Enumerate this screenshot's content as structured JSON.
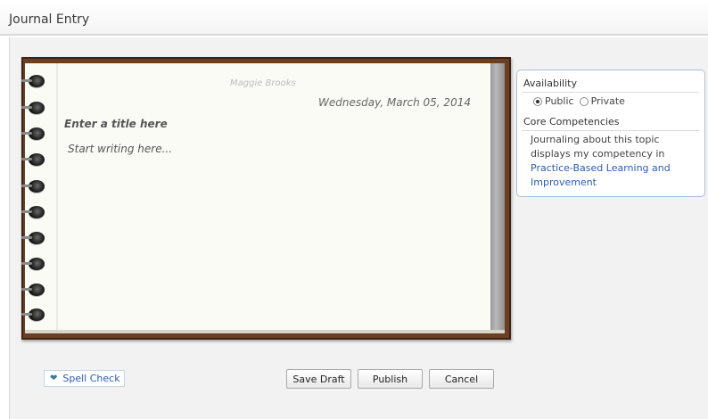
{
  "header": {
    "title": "Journal Entry"
  },
  "journal": {
    "author": "Maggie Brooks",
    "date": "Wednesday, March 05, 2014",
    "title_placeholder": "Enter a title here",
    "body_placeholder": "Start writing here..."
  },
  "side_panel": {
    "availability_title": "Availability",
    "options": [
      {
        "label": "Public",
        "checked": true
      },
      {
        "label": "Private",
        "checked": false
      }
    ],
    "competencies_title": "Core Competencies",
    "competency_text": "Journaling about this topic displays my competency in",
    "competency_link": "Practice-Based Learning and Improvement"
  },
  "actions": {
    "spell_check": "Spell Check",
    "save_draft": "Save Draft",
    "publish": "Publish",
    "cancel": "Cancel"
  },
  "icons": {
    "spell_check": "checkmark-heart-icon"
  },
  "colors": {
    "frame": "#6b3f24",
    "link": "#2a5db0",
    "panel_border": "#a9c0d6"
  }
}
